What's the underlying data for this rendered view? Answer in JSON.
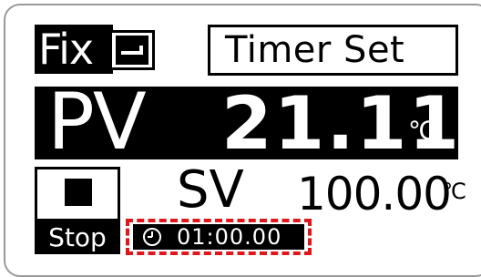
{
  "header": {
    "mode_label": "Fix",
    "mode_icon": "step-profile-icon",
    "timer_set_label": "Timer Set"
  },
  "pv": {
    "label": "PV",
    "value": "21.11",
    "unit": "℃"
  },
  "sv": {
    "label": "SV",
    "value": "100.00",
    "unit": "℃"
  },
  "run_control": {
    "stop_icon": "stop-square-icon",
    "stop_label": "Stop"
  },
  "timer": {
    "icon": "clock-icon",
    "value": "01:00.00"
  },
  "colors": {
    "highlight": "#e0161b",
    "display_fg": "#000000",
    "display_bg": "#ffffff"
  }
}
